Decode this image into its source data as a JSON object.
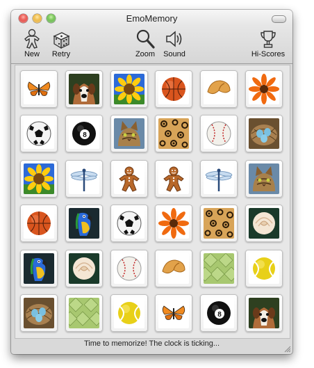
{
  "window": {
    "title": "EmoMemory"
  },
  "toolbar": {
    "new_label": "New",
    "retry_label": "Retry",
    "zoom_label": "Zoom",
    "sound_label": "Sound",
    "hiscores_label": "Hi-Scores"
  },
  "status": {
    "text": "Time to memorize! The clock is ticking..."
  },
  "board": {
    "columns": 6,
    "rows": 6,
    "cards": [
      [
        "butterfly",
        "dog",
        "sunflower",
        "basketball",
        "fortune-cookie",
        "orange-flower"
      ],
      [
        "soccer-ball",
        "eight-ball",
        "cat",
        "leopard-fur",
        "baseball",
        "bird-nest-eggs"
      ],
      [
        "sunflower",
        "dragonfly",
        "gingerbread",
        "gingerbread",
        "dragonfly",
        "cat"
      ],
      [
        "basketball",
        "parrot",
        "soccer-ball",
        "orange-flower",
        "leopard-fur",
        "rose"
      ],
      [
        "parrot",
        "rose",
        "baseball",
        "fortune-cookie",
        "green-leaf",
        "tennis-ball"
      ],
      [
        "bird-nest-eggs",
        "green-leaf",
        "tennis-ball",
        "butterfly",
        "eight-ball",
        "dog"
      ]
    ]
  }
}
